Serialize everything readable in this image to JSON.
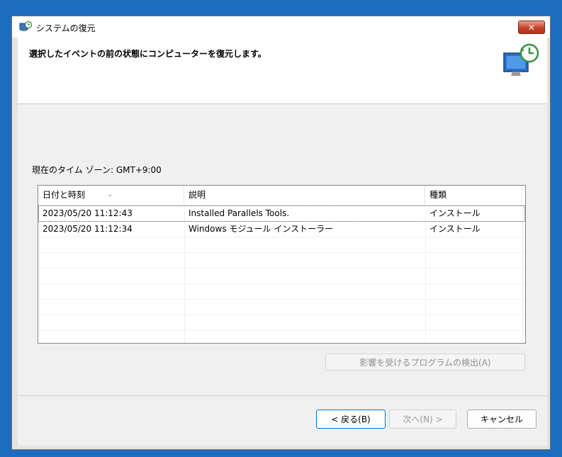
{
  "window": {
    "title": "システムの復元",
    "close_glyph": "✕"
  },
  "header": {
    "instruction": "選択したイベントの前の状態にコンピューターを復元します。"
  },
  "timezone_label": "現在のタイム ゾーン: GMT+9:00",
  "list": {
    "columns": [
      "日付と時刻",
      "説明",
      "種類"
    ],
    "sort_glyph": "⌄",
    "rows": [
      {
        "date": "2023/05/20 11:12:43",
        "description": "Installed Parallels Tools.",
        "type": "インストール"
      },
      {
        "date": "2023/05/20 11:12:34",
        "description": "Windows モジュール インストーラー",
        "type": "インストール"
      }
    ]
  },
  "buttons": {
    "affected_programs": "影響を受けるプログラムの検出(A)",
    "back": "< 戻る(B)",
    "next": "次へ(N) >",
    "cancel": "キャンセル"
  }
}
